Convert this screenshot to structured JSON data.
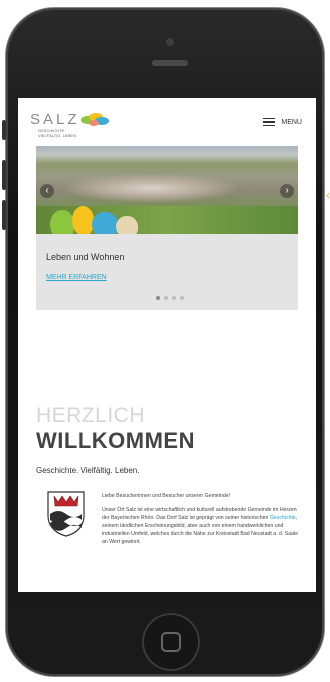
{
  "brand": {
    "word": "SALZ",
    "subline1": "GESCHICHTE.",
    "subline2": "VIELFÄLTIG. LEBEN."
  },
  "nav": {
    "menu_label": "MENU"
  },
  "slider": {
    "prev_icon": "chevron-left-icon",
    "next_icon": "chevron-right-icon",
    "caption_title": "Leben und Wohnen",
    "caption_link": "MEHR ERFAHREN"
  },
  "welcome": {
    "line1": "HERZLICH",
    "line2": "WILLKOMMEN",
    "tagline": "Geschichte. Vielfältig. Leben."
  },
  "intro": {
    "greeting": "Liebe Besucherinnen und Besucher unserer Gemeinde!",
    "body_part1": "Unser Ort Salz ist eine wirtschaftlich und kulturell aufstrebende Gemeinde im Herzen der Bayerischen Rhön. Das Dorf Salz ist geprägt von seiner historischen",
    "body_link": "Geschichte",
    "body_part2": ", seinem ländlichen Erscheinungsbild, aber auch von einem handwerklichen und industriellen Umfeld, welches durch die Nähe zur Kreisstadt Bad Neustadt a. d. Saale an Wert gewinnt."
  },
  "colors": {
    "accent_link": "#2aa7c9",
    "card_bg": "#e4e4e4",
    "heading_dark": "#444444",
    "heading_light": "#d6d6d6"
  }
}
